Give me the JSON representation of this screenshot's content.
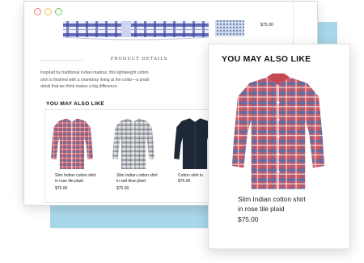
{
  "product_details": {
    "heading": "PRODUCT DETAILS",
    "description_lines": [
      "Inspired by traditional Indian madras, this lightweight cotton",
      "shirt is finished with a chambray lining at the collar—a small",
      "detail that we think makes a big difference."
    ]
  },
  "related": {
    "heading": "YOU MAY ALSO LIKE",
    "products": [
      {
        "name_line1": "Slim Indian cotton shirt",
        "name_line2": "in rose tile plaid",
        "price": "$75.00"
      },
      {
        "name_line1": "Slim Indian cotton shirt",
        "name_line2": "in salt blue plaid",
        "price": "$75.00"
      },
      {
        "name_line1": "Cotton shirt in",
        "name_line2": "$75.00",
        "price": ""
      }
    ]
  },
  "top_right": {
    "price": "$75.00"
  },
  "card": {
    "heading": "YOU MAY ALSO LIKE",
    "name_line1": "Slim Indian cotton shirt",
    "name_line2": "in rose tile plaid",
    "price": "$75.00"
  },
  "colors": {
    "backdrop": "#a9d7ea",
    "close_dot": "#f07e6e",
    "minimize_dot": "#f5c04a",
    "maximize_dot": "#60c95a",
    "plaid_red": "#d8555c",
    "plaid_blue": "#5a6fa6",
    "gray_plaid": "#8f959d",
    "navy_shirt": "#1e2838"
  }
}
